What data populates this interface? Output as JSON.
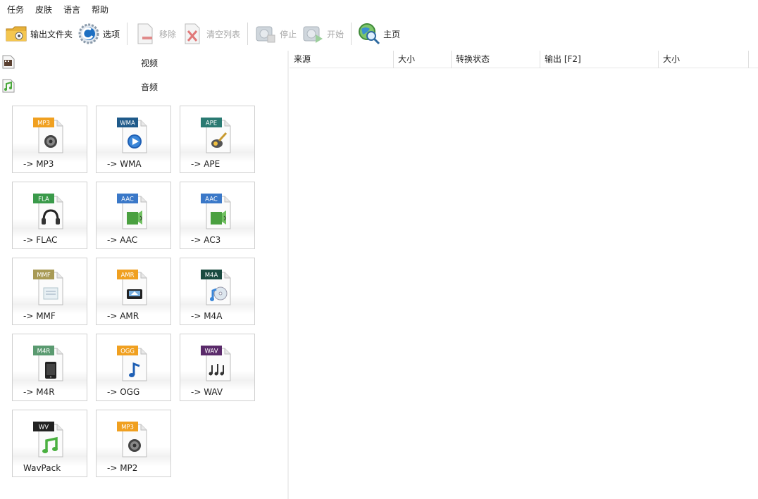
{
  "menu": [
    "任务",
    "皮肤",
    "语言",
    "帮助"
  ],
  "toolbar": {
    "output_folder": "输出文件夹",
    "options": "选项",
    "remove": "移除",
    "clear_list": "清空列表",
    "stop": "停止",
    "start": "开始",
    "home": "主页"
  },
  "categories": {
    "video": "视频",
    "audio": "音频"
  },
  "formats": [
    {
      "badge": "MP3",
      "label": "-> MP3",
      "color": "#f0a020",
      "glyph": "speaker"
    },
    {
      "badge": "WMA",
      "label": "-> WMA",
      "color": "#1f5a8a",
      "glyph": "play"
    },
    {
      "badge": "APE",
      "label": "-> APE",
      "color": "#2a7a72",
      "glyph": "guitar"
    },
    {
      "badge": "FLA",
      "label": "-> FLAC",
      "color": "#3a9a4a",
      "glyph": "headphones"
    },
    {
      "badge": "AAC",
      "label": "-> AAC",
      "color": "#3a78c8",
      "glyph": "speaker-note"
    },
    {
      "badge": "AAC",
      "label": "-> AC3",
      "color": "#3a78c8",
      "glyph": "speaker-note"
    },
    {
      "badge": "MMF",
      "label": "-> MMF",
      "color": "#a89a55",
      "glyph": "doc"
    },
    {
      "badge": "AMR",
      "label": "-> AMR",
      "color": "#f0a020",
      "glyph": "device"
    },
    {
      "badge": "M4A",
      "label": "-> M4A",
      "color": "#1a4a40",
      "glyph": "disc-note"
    },
    {
      "badge": "M4R",
      "label": "-> M4R",
      "color": "#5a9a70",
      "glyph": "phone"
    },
    {
      "badge": "OGG",
      "label": "-> OGG",
      "color": "#f0a020",
      "glyph": "note"
    },
    {
      "badge": "WAV",
      "label": "-> WAV",
      "color": "#5a2a6a",
      "glyph": "notes"
    },
    {
      "badge": "WV",
      "label": "WavPack",
      "color": "#222222",
      "glyph": "green-note"
    },
    {
      "badge": "MP3",
      "label": "-> MP2",
      "color": "#f0a020",
      "glyph": "speaker"
    }
  ],
  "table": {
    "columns": [
      "来源",
      "大小",
      "转换状态",
      "输出 [F2]",
      "大小"
    ]
  }
}
